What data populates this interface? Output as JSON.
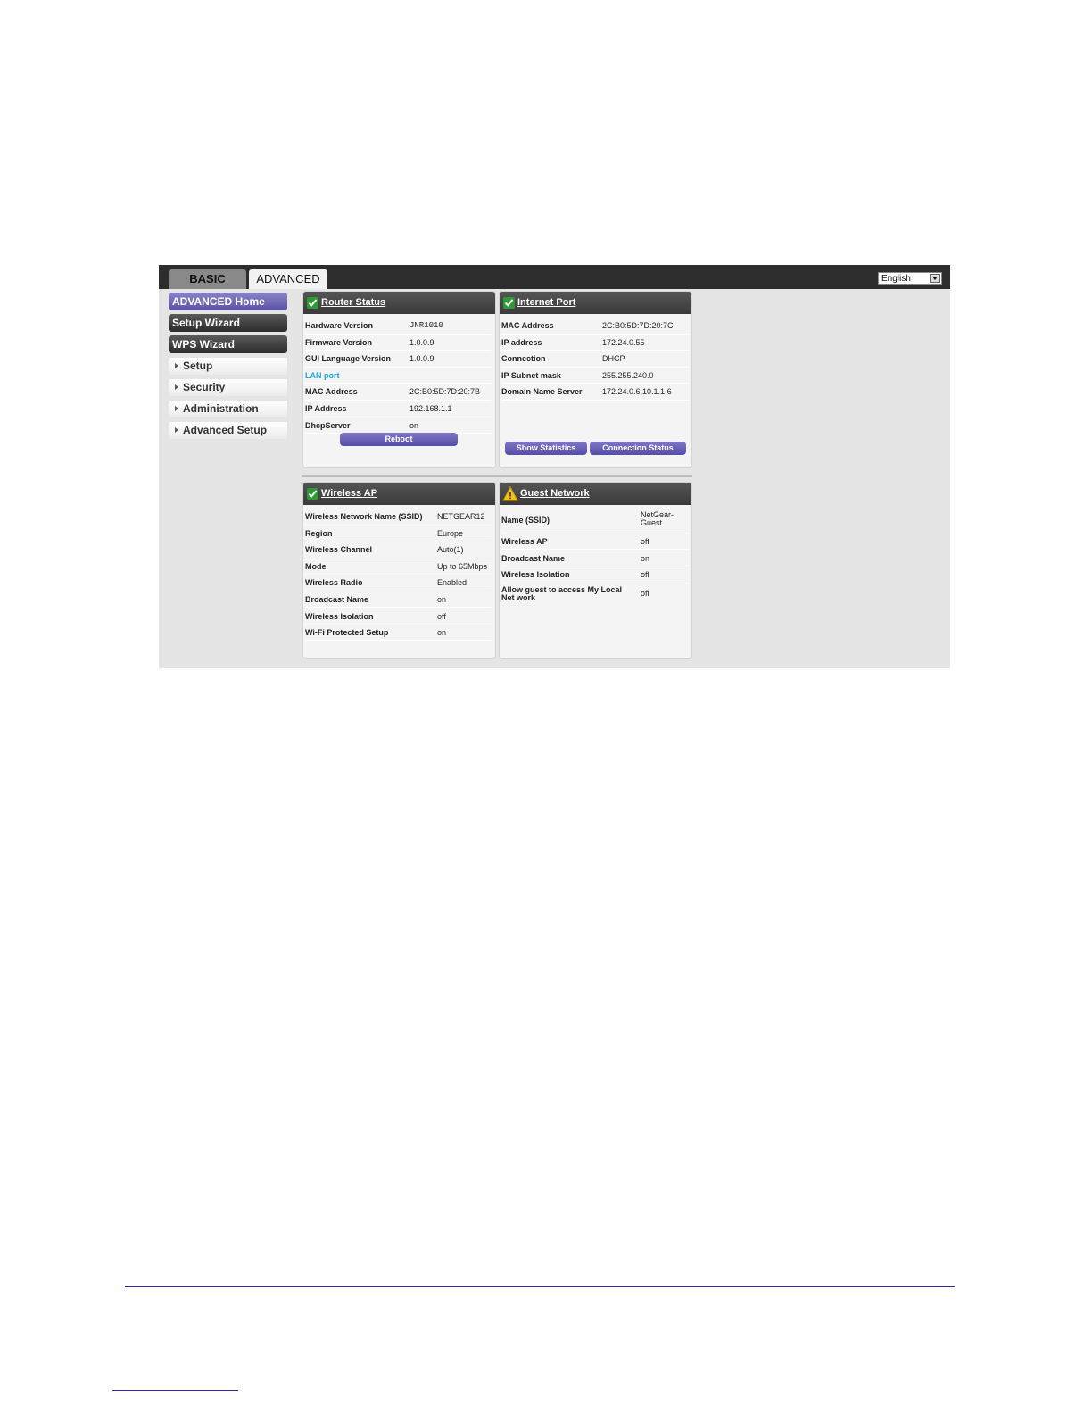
{
  "topbar": {
    "tabs": [
      {
        "label": "BASIC"
      },
      {
        "label": "ADVANCED"
      }
    ],
    "language": "English"
  },
  "sidebar": {
    "buttons": [
      "ADVANCED Home",
      "Setup Wizard",
      "WPS Wizard"
    ],
    "links": [
      "Setup",
      "Security",
      "Administration",
      "Advanced Setup"
    ]
  },
  "router_status": {
    "title": "Router Status",
    "rows": [
      {
        "k": "Hardware Version",
        "v": "JNR1010"
      },
      {
        "k": "Firmware Version",
        "v": "1.0.0.9"
      },
      {
        "k": "GUI Language Version",
        "v": "1.0.0.9"
      },
      {
        "k": "LAN port",
        "v": ""
      },
      {
        "k": "MAC Address",
        "v": "2C:B0:5D:7D:20:7B"
      },
      {
        "k": "IP Address",
        "v": "192.168.1.1"
      },
      {
        "k": "DhcpServer",
        "v": "on"
      }
    ],
    "reboot_label": "Reboot"
  },
  "internet_port": {
    "title": "Internet Port",
    "rows": [
      {
        "k": "MAC Address",
        "v": "2C:B0:5D:7D:20:7C"
      },
      {
        "k": "IP address",
        "v": "172.24.0.55"
      },
      {
        "k": "Connection",
        "v": "DHCP"
      },
      {
        "k": "IP Subnet mask",
        "v": "255.255.240.0"
      },
      {
        "k": "Domain Name Server",
        "v": "172.24.0.6,10.1.1.6"
      }
    ],
    "show_statistics_label": "Show Statistics",
    "connection_status_label": "Connection Status"
  },
  "wireless_ap": {
    "title": "Wireless AP",
    "rows": [
      {
        "k": "Wireless Network Name (SSID)",
        "v": "NETGEAR12"
      },
      {
        "k": "Region",
        "v": "Europe"
      },
      {
        "k": "Wireless Channel",
        "v": "Auto(1)"
      },
      {
        "k": "Mode",
        "v": "Up to 65Mbps"
      },
      {
        "k": "Wireless Radio",
        "v": "Enabled"
      },
      {
        "k": "Broadcast Name",
        "v": "on"
      },
      {
        "k": "Wireless Isolation",
        "v": "off"
      },
      {
        "k": "Wi-Fi Protected Setup",
        "v": "on"
      }
    ]
  },
  "guest_network": {
    "title": "Guest Network",
    "rows": [
      {
        "k": "Name (SSID)",
        "v": "NetGear-Guest"
      },
      {
        "k": "Wireless AP",
        "v": "off"
      },
      {
        "k": "Broadcast Name",
        "v": "on"
      },
      {
        "k": "Wireless Isolation",
        "v": "off"
      },
      {
        "k": "Allow guest to access My Local Net work",
        "v": "off"
      }
    ]
  },
  "colors": {
    "accent_purple": "#5a52a3",
    "ok_green": "#2f9a35",
    "warn_yellow": "#f2c21b",
    "lan_link": "#1aa5d8"
  }
}
